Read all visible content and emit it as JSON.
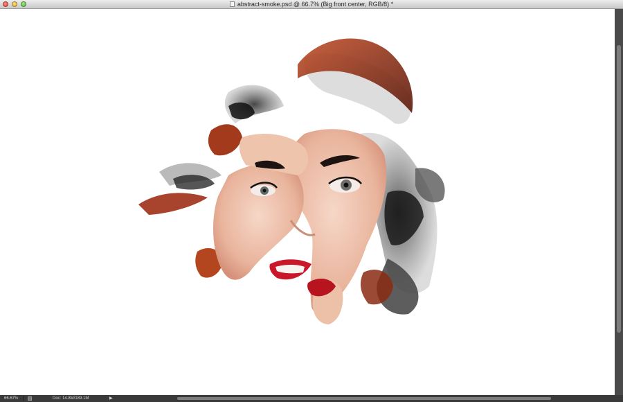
{
  "window": {
    "title": "abstract-smoke.psd @ 66.7% (Big front center, RGB/8) *"
  },
  "status": {
    "zoom": "66.67%",
    "doc_size": "Doc: 14.8M/189.1M",
    "menu_arrow": "▶"
  },
  "colors": {
    "titlebar_top": "#ececec",
    "titlebar_bottom": "#c9c9c9",
    "canvas": "#ffffff",
    "statusbar": "#3a3a3a",
    "scrollbar": "#4a4a4a"
  },
  "icons": {
    "document": "document-icon",
    "close": "close-window-icon",
    "minimize": "minimize-window-icon",
    "zoom": "zoom-window-icon",
    "proof": "proof-setup-icon"
  }
}
